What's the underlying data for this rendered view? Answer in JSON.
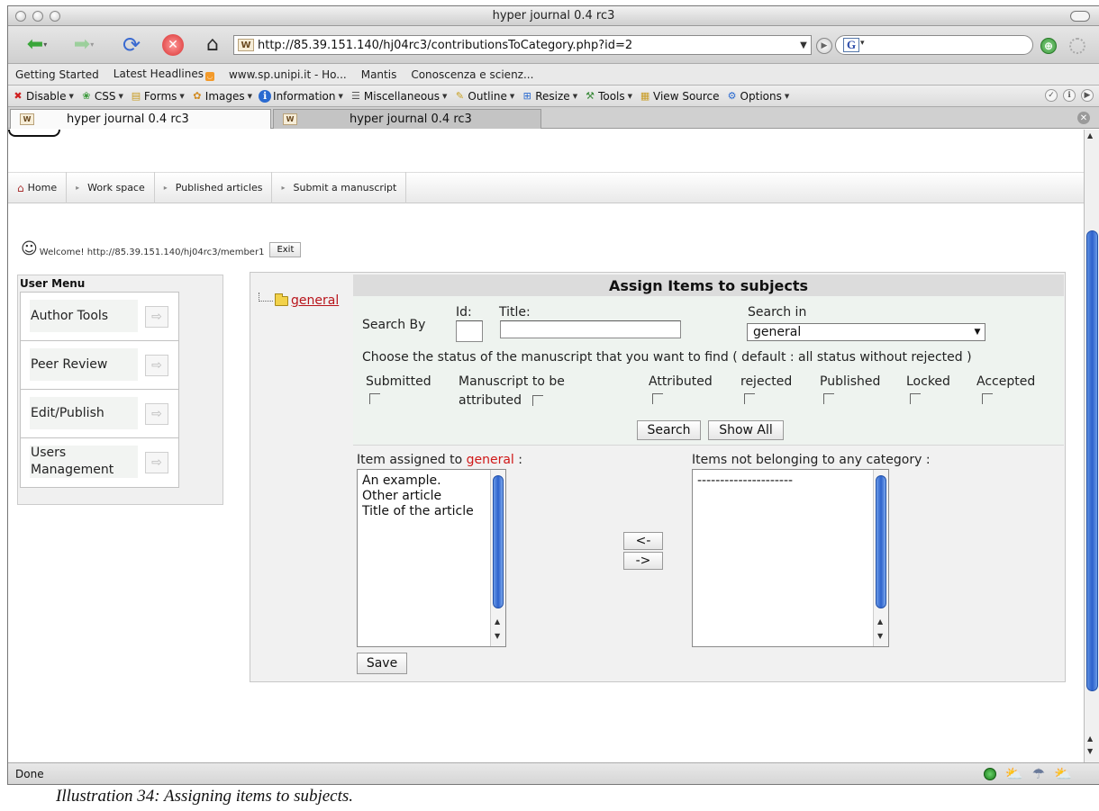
{
  "window": {
    "title": "hyper journal 0.4 rc3"
  },
  "nav": {
    "url": "http://85.39.151.140/hj04rc3/contributionsToCategory.php?id=2",
    "search_engine": "G"
  },
  "bookmarks": [
    "Getting Started",
    "Latest Headlines",
    "www.sp.unipi.it - Ho...",
    "Mantis",
    "Conoscenza e scienz..."
  ],
  "devbar": [
    {
      "label": "Disable",
      "icon": "✖"
    },
    {
      "label": "CSS",
      "icon": "❀"
    },
    {
      "label": "Forms",
      "icon": "▤"
    },
    {
      "label": "Images",
      "icon": "✿"
    },
    {
      "label": "Information",
      "icon": "ℹ"
    },
    {
      "label": "Miscellaneous",
      "icon": "☰"
    },
    {
      "label": "Outline",
      "icon": "✎"
    },
    {
      "label": "Resize",
      "icon": "⊞"
    },
    {
      "label": "Tools",
      "icon": "⚒"
    },
    {
      "label": "View Source",
      "icon": "▦"
    },
    {
      "label": "Options",
      "icon": "⚙"
    }
  ],
  "tabs": [
    {
      "label": "hyper journal 0.4 rc3",
      "active": true
    },
    {
      "label": "hyper journal 0.4 rc3",
      "active": false
    }
  ],
  "page": {
    "nav": [
      "Home",
      "Work space",
      "Published articles",
      "Submit a manuscript"
    ],
    "welcome": "Welcome! http://85.39.151.140/hj04rc3/member1",
    "exit_label": "Exit",
    "user_menu": {
      "title": "User Menu",
      "items": [
        "Author Tools",
        "Peer Review",
        "Edit/Publish",
        "Users Management"
      ]
    },
    "tree": {
      "node": "general"
    },
    "panel": {
      "title": "Assign Items to subjects",
      "search_by": "Search By",
      "id_label": "Id:",
      "title_label": "Title:",
      "id_value": "",
      "title_value": "",
      "search_in_label": "Search in",
      "search_in_value": "general",
      "status_help": "Choose the status of the manuscript that you want to find ( default : all status without rejected )",
      "statuses": [
        "Submitted",
        "Manuscript to be",
        "attributed",
        "Attributed",
        "rejected",
        "Published",
        "Locked",
        "Accepted"
      ],
      "search_button": "Search",
      "show_all_button": "Show All",
      "assigned_label_prefix": "Item assigned to",
      "assigned_label_category": "general",
      "assigned_label_suffix": ":",
      "assigned_items": [
        "An example.",
        "Other article",
        "Title of the article"
      ],
      "unassigned_label": "Items not belonging to any category :",
      "unassigned_items": [
        "---------------------"
      ],
      "move_left": "<-",
      "move_right": "->",
      "save_button": "Save"
    }
  },
  "status": {
    "text": "Done"
  },
  "caption": "Illustration 34: Assigning items to subjects.",
  "colors": {
    "link_red": "#b8141b",
    "scroll_blue": "#2d62cc",
    "panel_bg": "#eef3ef"
  }
}
